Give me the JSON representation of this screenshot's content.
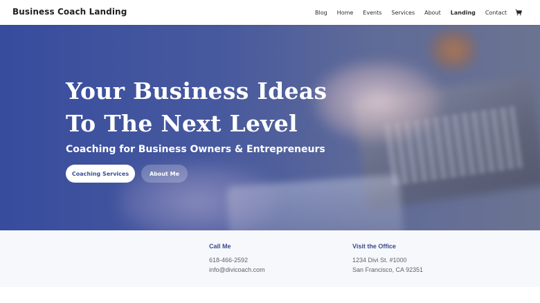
{
  "header": {
    "logo": "Business Coach Landing",
    "nav": [
      "Blog",
      "Home",
      "Events",
      "Services",
      "About",
      "Landing",
      "Contact"
    ],
    "active_nav": "Landing",
    "cart_icon": "shopping-cart-icon"
  },
  "hero": {
    "title_line1": "Your Business Ideas",
    "title_line2": "To The Next Level",
    "subtitle": "Coaching for Business Owners & Entrepreneurs",
    "primary_button": "Coaching Services",
    "secondary_button": "About Me"
  },
  "contact": {
    "call": {
      "heading": "Call Me",
      "phone": "618-466-2592",
      "email": "info@divicoach.com"
    },
    "office": {
      "heading": "Visit the Office",
      "address1": "1234 Divi St. #1000",
      "address2": "San Francisco, CA 92351"
    }
  },
  "colors": {
    "accent": "#3b4a8c",
    "hero_overlay": "#3a4fa0",
    "button_text": "#3a4f9c"
  }
}
